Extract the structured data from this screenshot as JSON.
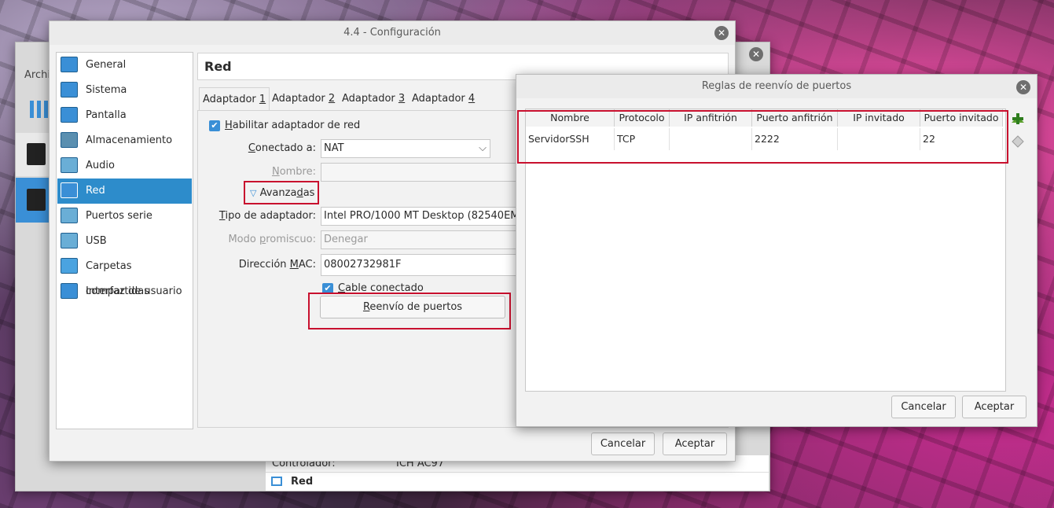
{
  "background_window": {
    "menu_partial": "Archi",
    "details": {
      "controller_label": "Controlador:",
      "controller_value": "ICH AC97",
      "section_label": "Red"
    }
  },
  "config_dialog": {
    "title": "4.4 - Configuración",
    "sidebar": {
      "items": [
        {
          "label": "General",
          "icon": "general-icon"
        },
        {
          "label": "Sistema",
          "icon": "system-icon"
        },
        {
          "label": "Pantalla",
          "icon": "display-icon"
        },
        {
          "label": "Almacenamiento",
          "icon": "storage-icon"
        },
        {
          "label": "Audio",
          "icon": "audio-icon"
        },
        {
          "label": "Red",
          "icon": "network-icon",
          "selected": true
        },
        {
          "label": "Puertos serie",
          "icon": "serial-ports-icon"
        },
        {
          "label": "USB",
          "icon": "usb-icon"
        },
        {
          "label": "Carpetas compartidas",
          "icon": "shared-folders-icon"
        },
        {
          "label": "Interfaz de usuario",
          "icon": "user-interface-icon"
        }
      ]
    },
    "section_title": "Red",
    "tabs": [
      {
        "pre": "Adaptador ",
        "key": "1",
        "selected": true
      },
      {
        "pre": "Adaptador ",
        "key": "2"
      },
      {
        "pre": "Adaptador ",
        "key": "3"
      },
      {
        "pre": "Adaptador ",
        "key": "4"
      }
    ],
    "enable_adapter": {
      "pre": "",
      "key": "H",
      "post": "abilitar adaptador de red",
      "checked": true
    },
    "attached_to": {
      "pre": "",
      "key": "C",
      "post": "onectado a:",
      "value": "NAT"
    },
    "name": {
      "pre": "",
      "key": "N",
      "post": "ombre:",
      "value": ""
    },
    "advanced": {
      "pre": "Avanza",
      "key": "d",
      "post": "as"
    },
    "adapter_type": {
      "pre": "",
      "key": "T",
      "post": "ipo de adaptador:",
      "value": "Intel PRO/1000 MT Desktop (82540EM)"
    },
    "promiscuous": {
      "pre": "Modo ",
      "key": "p",
      "post": "romiscuo:",
      "value": "Denegar"
    },
    "mac": {
      "pre": "Dirección ",
      "key": "M",
      "post": "AC:",
      "value": "08002732981F"
    },
    "cable": {
      "pre": "",
      "key": "C",
      "post": "able conectado",
      "checked": true
    },
    "port_forwarding_button": {
      "pre": "",
      "key": "R",
      "post": "eenvío de puertos"
    },
    "cancel": "Cancelar",
    "accept": "Aceptar"
  },
  "port_dialog": {
    "title": "Reglas de reenvío de puertos",
    "columns": [
      "Nombre",
      "Protocolo",
      "IP anfitrión",
      "Puerto anfitrión",
      "IP invitado",
      "Puerto invitado"
    ],
    "rows": [
      [
        "ServidorSSH",
        "TCP",
        "",
        "2222",
        "",
        "22"
      ]
    ],
    "cancel": "Cancelar",
    "accept": "Aceptar"
  }
}
